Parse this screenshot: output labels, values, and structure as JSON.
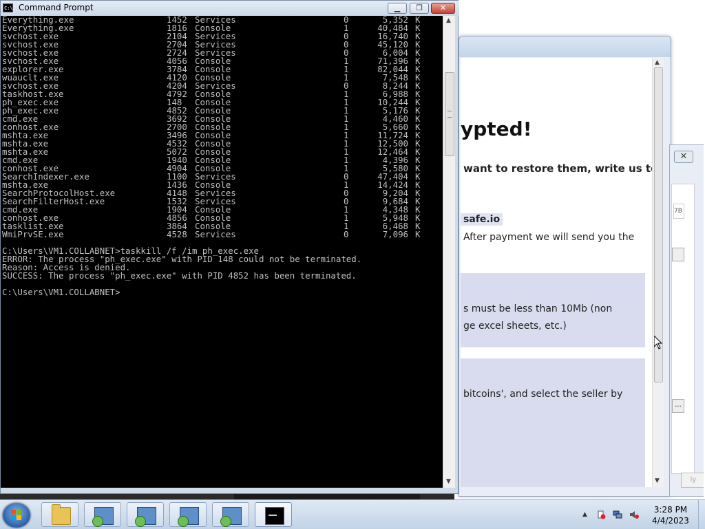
{
  "cmd": {
    "title": "Command Prompt",
    "icon_text": "C:\\",
    "min_label": "▭",
    "max_label": "❐",
    "close_label": "✕",
    "processes": [
      {
        "name": "Everything.exe",
        "pid": "1452",
        "session": "Services",
        "num": "0",
        "mem": "5,352",
        "unit": "K"
      },
      {
        "name": "Everything.exe",
        "pid": "1816",
        "session": "Console",
        "num": "1",
        "mem": "40,484",
        "unit": "K"
      },
      {
        "name": "svchost.exe",
        "pid": "2104",
        "session": "Services",
        "num": "0",
        "mem": "16,740",
        "unit": "K"
      },
      {
        "name": "svchost.exe",
        "pid": "2704",
        "session": "Services",
        "num": "0",
        "mem": "45,120",
        "unit": "K"
      },
      {
        "name": "svchost.exe",
        "pid": "2724",
        "session": "Services",
        "num": "0",
        "mem": "6,004",
        "unit": "K"
      },
      {
        "name": "svchost.exe",
        "pid": "4056",
        "session": "Console",
        "num": "1",
        "mem": "71,396",
        "unit": "K"
      },
      {
        "name": "explorer.exe",
        "pid": "3784",
        "session": "Console",
        "num": "1",
        "mem": "82,044",
        "unit": "K"
      },
      {
        "name": "wuauclt.exe",
        "pid": "4120",
        "session": "Console",
        "num": "1",
        "mem": "7,548",
        "unit": "K"
      },
      {
        "name": "svchost.exe",
        "pid": "4204",
        "session": "Services",
        "num": "0",
        "mem": "8,244",
        "unit": "K"
      },
      {
        "name": "taskhost.exe",
        "pid": "4792",
        "session": "Console",
        "num": "1",
        "mem": "6,988",
        "unit": "K"
      },
      {
        "name": "ph_exec.exe",
        "pid": "148",
        "session": "Console",
        "num": "1",
        "mem": "10,244",
        "unit": "K"
      },
      {
        "name": "ph_exec.exe",
        "pid": "4852",
        "session": "Console",
        "num": "1",
        "mem": "5,176",
        "unit": "K"
      },
      {
        "name": "cmd.exe",
        "pid": "3692",
        "session": "Console",
        "num": "1",
        "mem": "4,460",
        "unit": "K"
      },
      {
        "name": "conhost.exe",
        "pid": "2700",
        "session": "Console",
        "num": "1",
        "mem": "5,660",
        "unit": "K"
      },
      {
        "name": "mshta.exe",
        "pid": "3496",
        "session": "Console",
        "num": "1",
        "mem": "11,724",
        "unit": "K"
      },
      {
        "name": "mshta.exe",
        "pid": "4532",
        "session": "Console",
        "num": "1",
        "mem": "12,500",
        "unit": "K"
      },
      {
        "name": "mshta.exe",
        "pid": "5072",
        "session": "Console",
        "num": "1",
        "mem": "12,464",
        "unit": "K"
      },
      {
        "name": "cmd.exe",
        "pid": "1940",
        "session": "Console",
        "num": "1",
        "mem": "4,396",
        "unit": "K"
      },
      {
        "name": "conhost.exe",
        "pid": "4904",
        "session": "Console",
        "num": "1",
        "mem": "5,580",
        "unit": "K"
      },
      {
        "name": "SearchIndexer.exe",
        "pid": "1100",
        "session": "Services",
        "num": "0",
        "mem": "47,404",
        "unit": "K"
      },
      {
        "name": "mshta.exe",
        "pid": "1436",
        "session": "Console",
        "num": "1",
        "mem": "14,424",
        "unit": "K"
      },
      {
        "name": "SearchProtocolHost.exe",
        "pid": "4148",
        "session": "Services",
        "num": "0",
        "mem": "9,204",
        "unit": "K"
      },
      {
        "name": "SearchFilterHost.exe",
        "pid": "1532",
        "session": "Services",
        "num": "0",
        "mem": "9,684",
        "unit": "K"
      },
      {
        "name": "cmd.exe",
        "pid": "1904",
        "session": "Console",
        "num": "1",
        "mem": "4,348",
        "unit": "K"
      },
      {
        "name": "conhost.exe",
        "pid": "4856",
        "session": "Console",
        "num": "1",
        "mem": "5,948",
        "unit": "K"
      },
      {
        "name": "tasklist.exe",
        "pid": "3864",
        "session": "Console",
        "num": "1",
        "mem": "6,468",
        "unit": "K"
      },
      {
        "name": "WmiPrvSE.exe",
        "pid": "4528",
        "session": "Services",
        "num": "0",
        "mem": "7,096",
        "unit": "K"
      }
    ],
    "lines": [
      "",
      "C:\\Users\\VM1.COLLABNET>taskkill /f /im ph_exec.exe",
      "ERROR: The process \"ph_exec.exe\" with PID 148 could not be terminated.",
      "Reason: Access is denied.",
      "SUCCESS: The process \"ph_exec.exe\" with PID 4852 has been terminated.",
      "",
      "C:\\Users\\VM1.COLLABNET>"
    ]
  },
  "ransom": {
    "heading": "ypted!",
    "line1": "want to restore them, write us to",
    "email": "safe.io",
    "line2": "After payment we will send you the",
    "line3": "s must be less than 10Mb (non",
    "line4": "ge excel sheets, etc.)",
    "line5": "bitcoins', and select the seller by"
  },
  "dialog3": {
    "field_text": "7B",
    "btn_text": "...",
    "bottom_btn": "ly"
  },
  "taskbar": {
    "time": "3:28 PM",
    "date": "4/4/2023",
    "show_hidden": "▲"
  },
  "colors": {
    "console_bg": "#000000",
    "console_fg": "#c0c0c0",
    "ransom_box": "#d9dcee"
  }
}
